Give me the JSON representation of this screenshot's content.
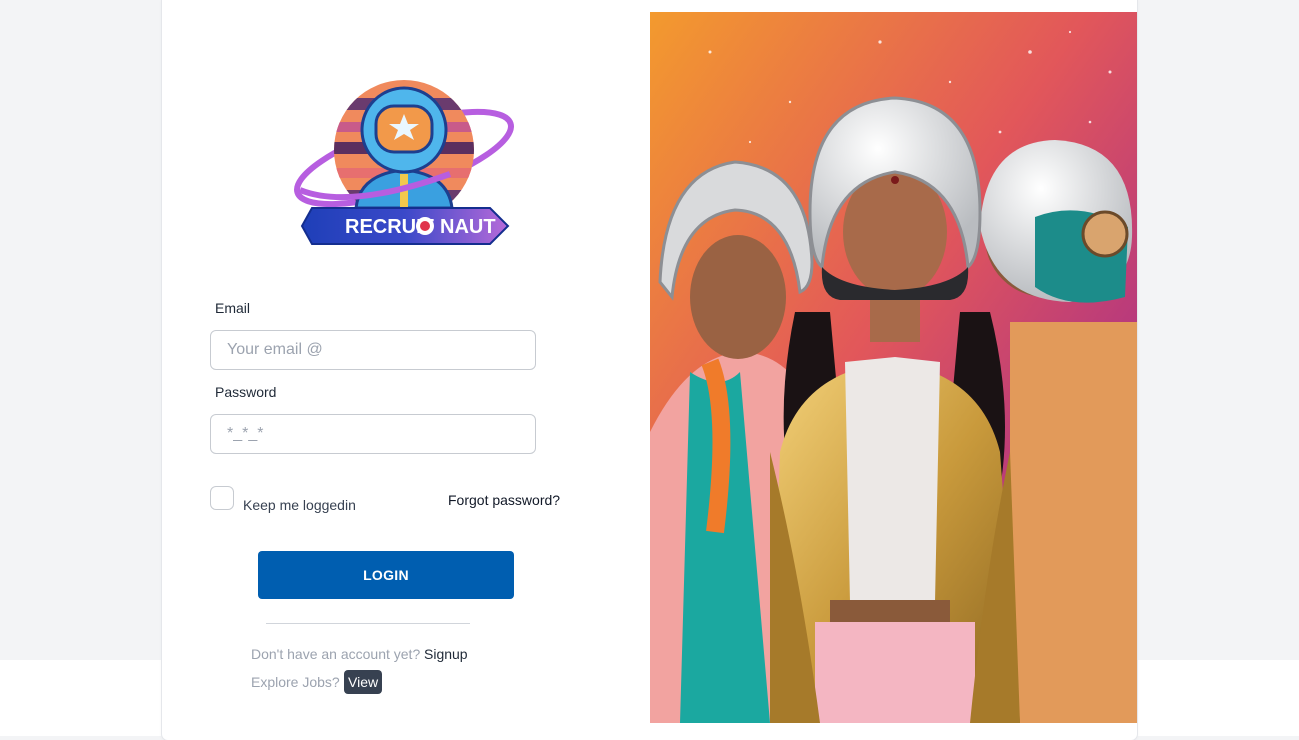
{
  "brand": {
    "logo_text_left": "RECRUIT",
    "logo_text_right": "NAUT"
  },
  "form": {
    "email_label": "Email",
    "email_placeholder": "Your email @",
    "password_label": "Password",
    "password_placeholder": "*_*_*",
    "keep_logged_in_label": "Keep me loggedin",
    "keep_logged_in_checked": false,
    "forgot_password_label": "Forgot password?",
    "login_button_label": "LOGIN"
  },
  "footer": {
    "no_account_text": "Don't have an account yet?",
    "signup_label": "Signup",
    "explore_text": "Explore Jobs?",
    "view_label": "View"
  },
  "hero": {
    "image_semantic": "three-women-in-space-helmets-illustration"
  },
  "colors": {
    "accent": "#005eb0",
    "page_background": "#f3f4f6",
    "view_button": "#374151"
  }
}
